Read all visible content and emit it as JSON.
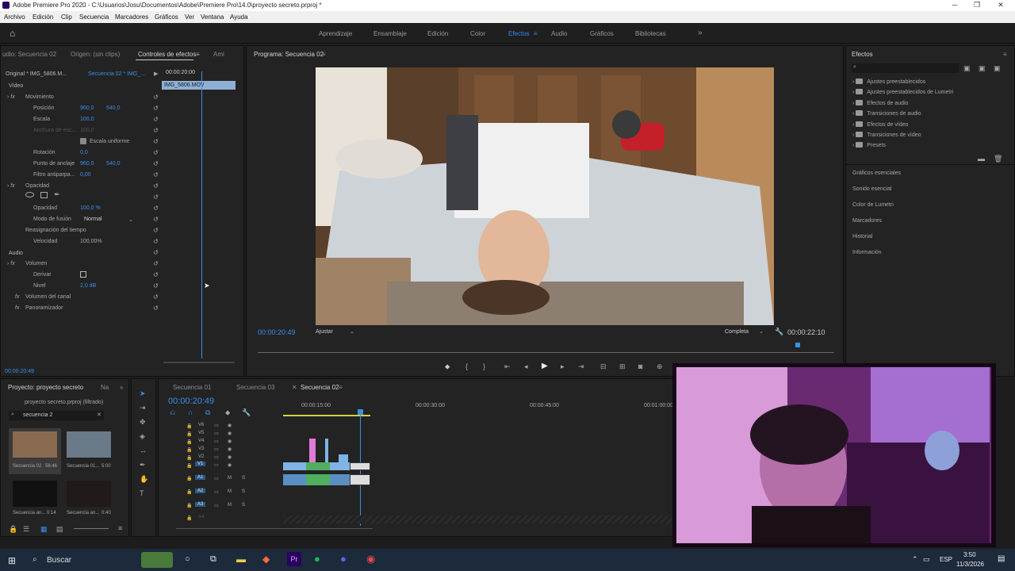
{
  "window": {
    "title": "Adobe Premiere Pro 2020 - C:\\Usuarios\\Josu\\Documentos\\Adobe\\Premiere Pro\\14.0\\proyecto secreto.prproj *"
  },
  "menu": [
    "Archivo",
    "Edición",
    "Clip",
    "Secuencia",
    "Marcadores",
    "Gráficos",
    "Ver",
    "Ventana",
    "Ayuda"
  ],
  "workspaces": {
    "items": [
      "Aprendizaje",
      "Ensamblaje",
      "Edición",
      "Color",
      "Efectos",
      "Audio",
      "Gráficos",
      "Bibliotecas"
    ],
    "active": "Efectos"
  },
  "effect_controls": {
    "tabs": [
      "udio: Secuencia 02",
      "Origen: (sin clips)",
      "Controles de efectos",
      "Ami"
    ],
    "source": "Original * IMG_5806.M...",
    "sequence": "Secuencia 02 * IMG_...",
    "time_ruler": "00:00:20:00",
    "clip_name": "IMG_5806.MOV",
    "current_time": "00:00:20:49",
    "video_header": "Vídeo",
    "movimiento": "Movimiento",
    "posicion_label": "Posición",
    "posicion_x": "960,0",
    "posicion_y": "540,0",
    "escala_label": "Escala",
    "escala": "100,0",
    "anchura_label": "Anchura de esc...",
    "anchura": "100,0",
    "escala_uniforme": "Escala uniforme",
    "rotacion_label": "Rotación",
    "rotacion": "0,0",
    "anclaje_label": "Punto de anclaje",
    "anclaje_x": "960,0",
    "anclaje_y": "540,0",
    "filtro_label": "Filtro antiparpa...",
    "filtro": "0,00",
    "opacidad_header": "Opacidad",
    "opacidad_label": "Opacidad",
    "opacidad": "100,0 %",
    "fusion_label": "Modo de fusión",
    "fusion": "Normal",
    "reasignacion": "Reasignación del tiempo",
    "velocidad_label": "Velocidad",
    "velocidad": "100,00%",
    "audio_header": "Audio",
    "volumen": "Volumen",
    "derivar_label": "Derivar",
    "nivel_label": "Nivel",
    "nivel": "2,0 dB",
    "volumen_canal": "Volumen del canal",
    "panoramizador": "Panoramizador"
  },
  "program": {
    "tab": "Programa: Secuencia 02",
    "timecode": "00:00:20:49",
    "fit": "Ajustar",
    "quality": "Completa",
    "duration": "00:00:22:10"
  },
  "effects_panel": {
    "tab": "Efectos",
    "folders": [
      "Ajustes preestablecidos",
      "Ajustes preestablecidos de Lumetri",
      "Efectos de audio",
      "Transiciones de audio",
      "Efectos de vídeo",
      "Transiciones de vídeo",
      "Presets"
    ],
    "sections": [
      "Gráficos esenciales",
      "Sonido esencial",
      "Color de Lumetri",
      "Marcadores",
      "Historial",
      "Información"
    ]
  },
  "project": {
    "tabs": [
      "Proyecto: proyecto secreto",
      "Na"
    ],
    "file": "proyecto secreto.prproj (filtrado)",
    "search": "secuencia 2",
    "items": [
      {
        "name": "Secuencia 02",
        "duration": "56:46"
      },
      {
        "name": "Secuencia 01...",
        "duration": "5:00"
      },
      {
        "name": "Secuencia an...",
        "duration": "0:14"
      },
      {
        "name": "Secuencia an...",
        "duration": "0:40"
      }
    ]
  },
  "timeline": {
    "tabs": [
      "Secuencia 01",
      "Secuencia 03",
      "Secuencia 02"
    ],
    "active": "Secuencia 02",
    "timecode": "00:00:20:49",
    "ruler": [
      "00:00:15:00",
      "00:00:30:00",
      "00:00:45:00",
      "00:01:00:00"
    ],
    "video_tracks": [
      "V6",
      "V5",
      "V4",
      "V3",
      "V2",
      "V1"
    ],
    "audio_tracks": [
      "A1",
      "A2",
      "A3",
      "A4"
    ]
  },
  "taskbar": {
    "search": "Buscar",
    "lang": "ESP",
    "time": "3:50",
    "date": "11/3/2026"
  },
  "colors": {
    "accent": "#2d8ceb",
    "video_clip": "#7fb4e6",
    "audio_clip": "#4fae5f",
    "pink_clip": "#e07bd6"
  }
}
